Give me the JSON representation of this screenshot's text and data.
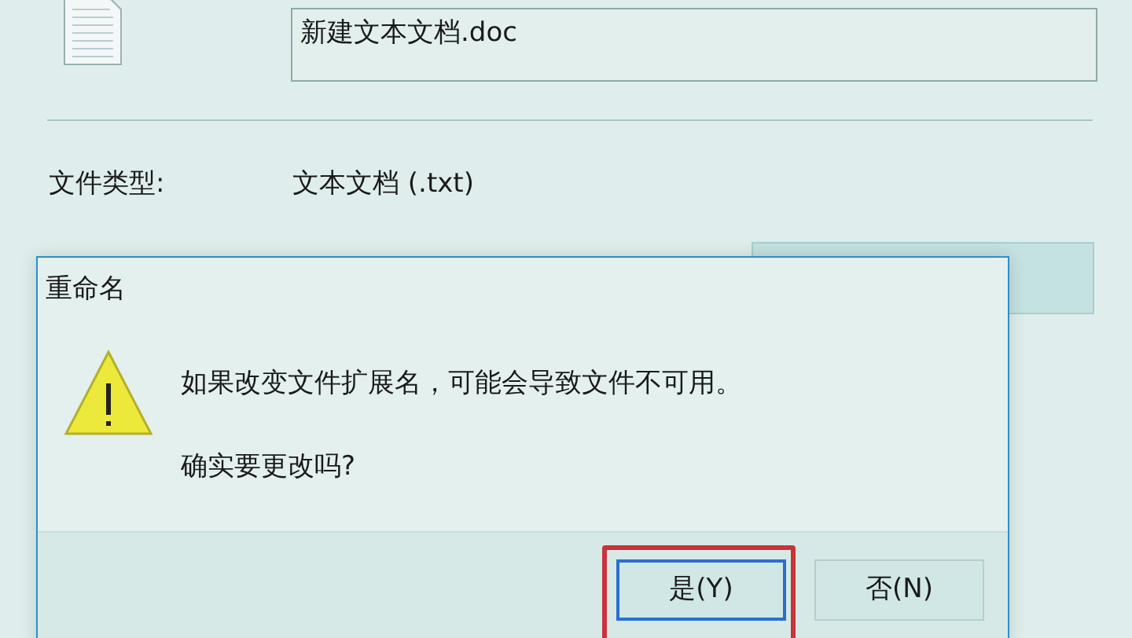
{
  "properties": {
    "file_name": "新建文本文档.doc",
    "file_type_label": "文件类型:",
    "file_type_value": "文本文档 (.txt)"
  },
  "dialog": {
    "title": "重命名",
    "message": "如果改变文件扩展名，可能会导致文件不可用。",
    "question": "确实要更改吗?",
    "buttons": [
      {
        "label": "是(Y)",
        "default": true,
        "highlighted": true
      },
      {
        "label": "否(N)",
        "default": false,
        "highlighted": false
      }
    ]
  }
}
